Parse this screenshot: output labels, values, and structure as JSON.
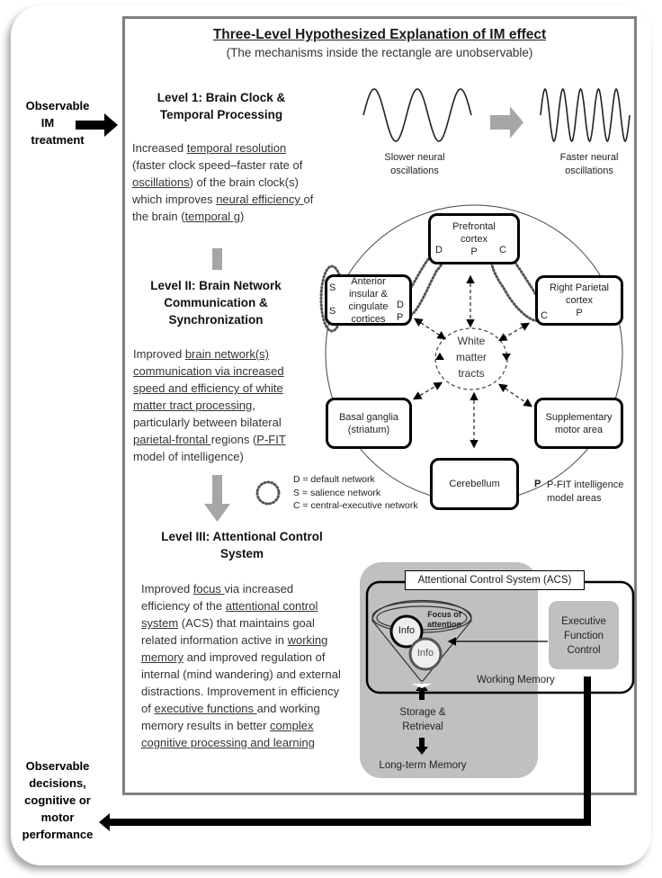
{
  "title": "Three-Level Hypothesized Explanation of IM effect",
  "subtitle": "(The mechanisms inside the rectangle  are unobservable)",
  "input": {
    "line1": "Observable",
    "line2": "IM",
    "line3": "treatment"
  },
  "output": {
    "line1": "Observable",
    "line2": "decisions,",
    "line3": "cognitive or",
    "line4": "motor",
    "line5": "performance"
  },
  "level1": {
    "heading_line1": "Level 1:  Brain Clock &",
    "heading_line2": "Temporal Processing",
    "text": [
      {
        "t": "Increased ",
        "u": false
      },
      {
        "t": " temporal resolution",
        "u": true
      },
      {
        "t": " (faster clock speed–faster rate of ",
        "u": false
      },
      {
        "t": "oscillations",
        "u": true
      },
      {
        "t": ") of the brain clock(s) which improves ",
        "u": false
      },
      {
        "t": "neural efficiency ",
        "u": true
      },
      {
        "t": "of the brain (",
        "u": false
      },
      {
        "t": "temporal g",
        "u": true
      },
      {
        "t": ")",
        "u": false
      }
    ],
    "slow_label_1": "Slower neural",
    "slow_label_2": "oscillations",
    "fast_label_1": "Faster neural",
    "fast_label_2": "oscillations"
  },
  "level2": {
    "heading_line1": "Level II:  Brain Network",
    "heading_line2": "Communication &",
    "heading_line3": "Synchronization",
    "text": [
      {
        "t": "Improved ",
        "u": false
      },
      {
        "t": "brain network(s) communication via increased speed and efficiency of white matter tract processing",
        "u": true
      },
      {
        "t": ", particularly between bilateral ",
        "u": false
      },
      {
        "t": "parietal-frontal ",
        "u": true
      },
      {
        "t": "regions (",
        "u": false
      },
      {
        "t": "P-FIT",
        "u": true
      },
      {
        "t": " model of intelligence)",
        "u": false
      }
    ]
  },
  "network": {
    "center": {
      "line1": "White",
      "line2": "matter",
      "line3": "tracts"
    },
    "nodes": {
      "prefrontal": {
        "line1": "Prefrontal",
        "line2": "cortex",
        "p": "P",
        "d": "D",
        "c": "C"
      },
      "anterior": {
        "line1": "Anterior",
        "line2": "insular &",
        "line3": "cingulate",
        "line4": "cortices",
        "s1": "S",
        "s2": "S",
        "d": "D",
        "p": "P"
      },
      "parietal": {
        "line1": "Right Parietal",
        "line2": "cortex",
        "p": "P",
        "c": "C"
      },
      "basal": {
        "line1": "Basal ganglia",
        "line2": "(striatum)"
      },
      "sma": {
        "line1": "Supplementary",
        "line2": "motor area"
      },
      "cerebellum": {
        "line1": "Cerebellum"
      }
    },
    "legend": {
      "d": "D = default network",
      "s": "S = salience network",
      "c": "C = central-executive network",
      "p_symbol": "P",
      "p_line1": "P-FIT intelligence",
      "p_line2": "model areas"
    }
  },
  "level3": {
    "heading_line1": "Level III:  Attentional Control",
    "heading_line2": "System",
    "text": [
      {
        "t": "Improved ",
        "u": false
      },
      {
        "t": "focus ",
        "u": true
      },
      {
        "t": "via increased efficiency of the ",
        "u": false
      },
      {
        "t": "attentional control system",
        "u": true
      },
      {
        "t": " (ACS) that maintains goal related information active in ",
        "u": false
      },
      {
        "t": "working memory",
        "u": true
      },
      {
        "t": " and improved regulation of internal (mind wandering) and external distractions. Improvement in efficiency of ",
        "u": false
      },
      {
        "t": "executive functions ",
        "u": true
      },
      {
        "t": "and working memory results in better  ",
        "u": false
      },
      {
        "t": "complex cognitive processing and learning",
        "u": true
      }
    ]
  },
  "acs": {
    "label": "Attentional Control System  (ACS)",
    "focus_1": "Focus of",
    "focus_2": "attention",
    "info1": "Info",
    "info2": "Info",
    "efc_1": "Executive",
    "efc_2": "Function",
    "efc_3": "Control",
    "working_memory": "Working Memory",
    "storage_1": "Storage &",
    "storage_2": "Retrieval",
    "ltm": "Long-term Memory"
  },
  "colors": {
    "frame": "#7f7f7f",
    "gray_fill": "#c0c0c0",
    "arrow_gray": "#a6a6a6",
    "ink": "#000000"
  }
}
